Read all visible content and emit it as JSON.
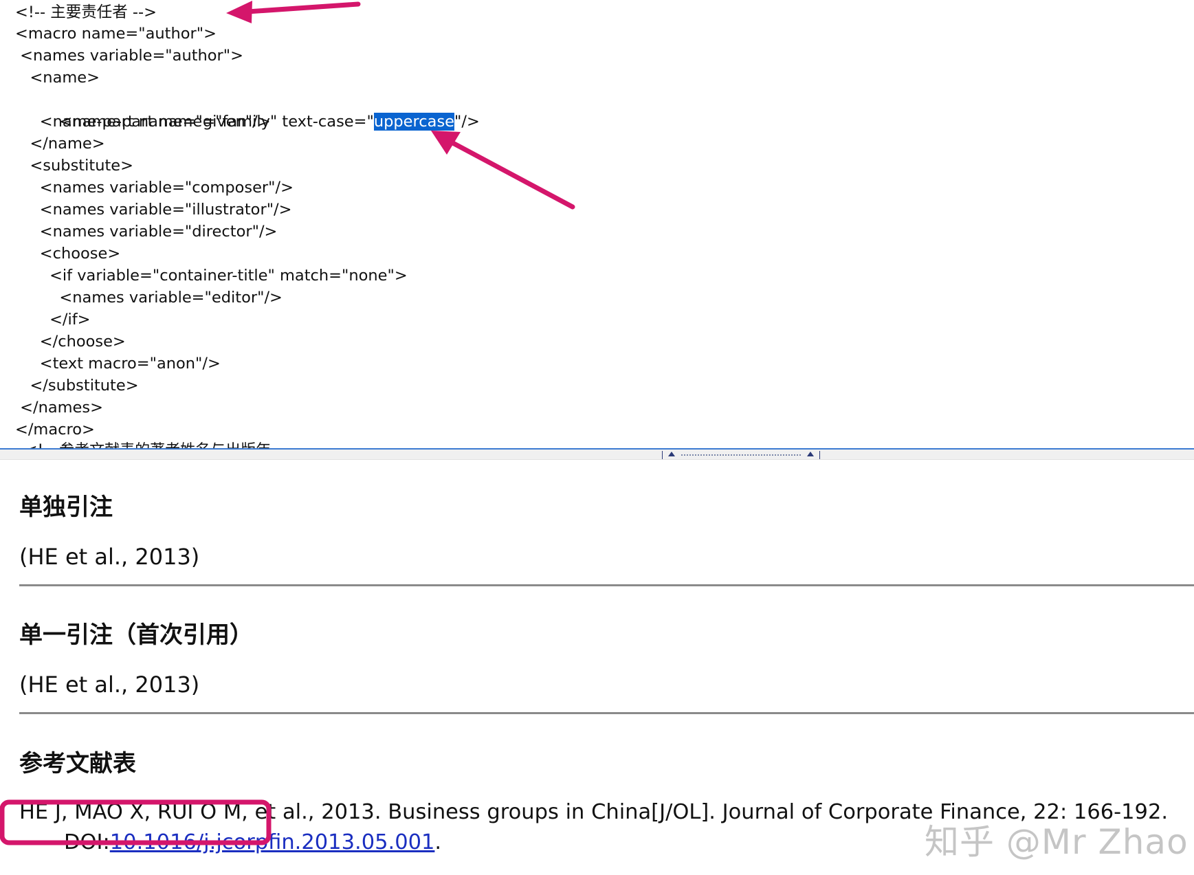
{
  "editor": {
    "code_lines": [
      "<!-- 主要责任者 -->",
      "<macro name=\"author\">",
      " <names variable=\"author\">",
      "   <name>",
      "     <name-part name=\"family\" text-case=\"",
      "     <name-part name=\"given\"/>",
      "   </name>",
      "   <substitute>",
      "     <names variable=\"composer\"/>",
      "     <names variable=\"illustrator\"/>",
      "     <names variable=\"director\"/>",
      "     <choose>",
      "       <if variable=\"container-title\" match=\"none\">",
      "         <names variable=\"editor\"/>",
      "       </if>",
      "     </choose>",
      "     <text macro=\"anon\"/>",
      "   </substitute>",
      " </names>",
      "</macro>"
    ],
    "selected_text": "uppercase",
    "after_selection": "\"/>",
    "cut_off_line": "<!-- 参考文献表的著者姓名与出版年"
  },
  "preview": {
    "section1_heading": "单独引注",
    "section1_citation": "(HE et al., 2013)",
    "section2_heading": "单一引注（首次引用）",
    "section2_citation": "(HE et al., 2013)",
    "section3_heading": "参考文献表",
    "bib_entry_prefix": "HE J, MAO X, RUI O M, et al., 2013. Business groups in China[J/OL]. Journal of Corporate Finance, 22: 166-192. DOI:",
    "bib_entry_doi": "10.1016/j.jcorpfin.2013.05.001",
    "bib_entry_suffix": "."
  },
  "watermark": "知乎 @Mr Zhao",
  "colors": {
    "annotation_magenta": "#d4166b",
    "selection_blue": "#0a64d0",
    "link_blue": "#1a2ec0"
  }
}
